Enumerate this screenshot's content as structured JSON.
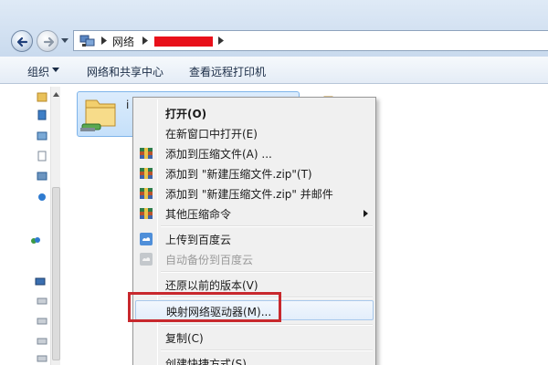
{
  "address_bar": {
    "breadcrumb": [
      "网络"
    ],
    "redacted_crumb": "",
    "icons": {
      "back": "back-arrow-icon",
      "forward": "forward-arrow-icon",
      "location": "network-icon",
      "separator": "chevron-right-icon"
    }
  },
  "command_bar": {
    "organize": "组织",
    "network_sharing_center": "网络和共享中心",
    "view_remote_printers": "查看远程打印机"
  },
  "file_area": {
    "selected_item_label_fragment": "i"
  },
  "context_menu": {
    "items": [
      {
        "label": "打开(O)",
        "bold": true,
        "icon": ""
      },
      {
        "label": "在新窗口中打开(E)",
        "icon": ""
      },
      {
        "label": "添加到压缩文件(A) ...",
        "icon": "archive-icon"
      },
      {
        "label": "添加到 \"新建压缩文件.zip\"(T)",
        "icon": "archive-icon"
      },
      {
        "label": "添加到 \"新建压缩文件.zip\" 并邮件",
        "icon": "archive-icon"
      },
      {
        "label": "其他压缩命令",
        "icon": "archive-icon",
        "submenu": true
      },
      {
        "label": "上传到百度云",
        "icon": "baidu-cloud-icon"
      },
      {
        "label": "自动备份到百度云",
        "icon": "baidu-cloud-icon",
        "disabled": true
      },
      {
        "label": "还原以前的版本(V)",
        "icon": ""
      },
      {
        "label": "映射网络驱动器(M)...",
        "icon": "",
        "highlighted": true
      },
      {
        "label": "复制(C)",
        "icon": ""
      },
      {
        "label": "创建快捷方式(S)",
        "icon": ""
      }
    ]
  },
  "colors": {
    "highlight_border": "#c8282d",
    "redaction": "#e8101a",
    "selection": "#c5e0fa"
  }
}
